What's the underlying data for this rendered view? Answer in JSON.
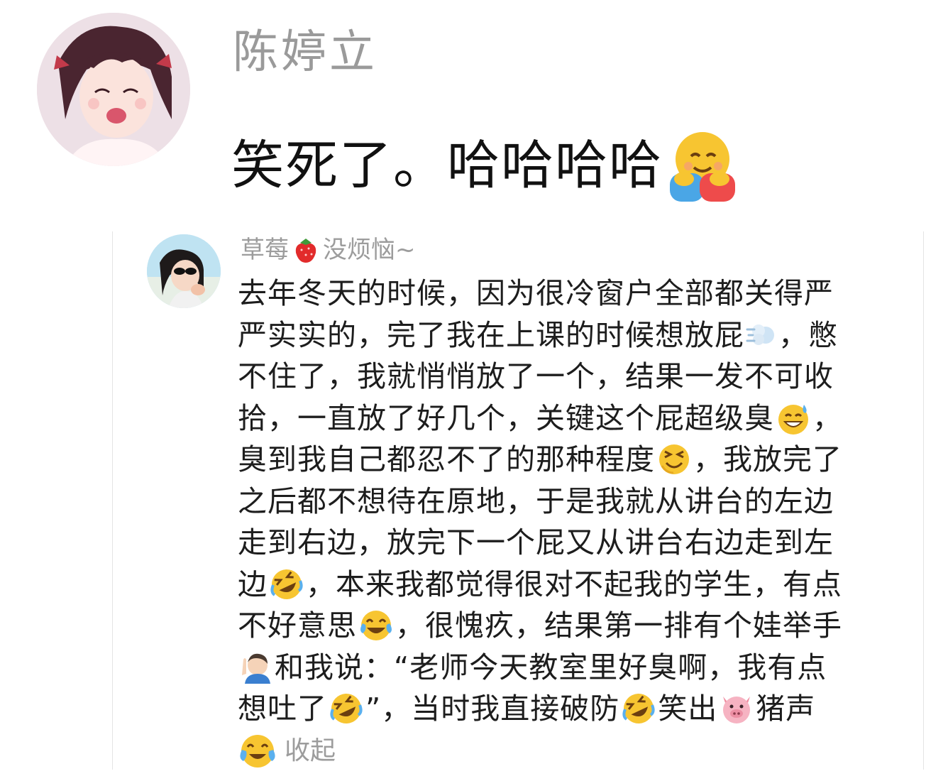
{
  "top_comment": {
    "username": "陈婷立",
    "text": "笑死了。哈哈哈哈",
    "trailing_emoji": "hugging-face-icon"
  },
  "quoted_comment": {
    "username_part1": "草莓",
    "name_emoji": "strawberry-icon",
    "username_part2": "没烦恼~",
    "lines": [
      [
        "去年冬天的时候，因为很冷窗户全部都关得严"
      ],
      [
        "严实实的，完了我在上课的时候想放屁",
        "[dash-emoji]",
        "，憋"
      ],
      [
        "不住了，我就悄悄放了一个，结果一发不可收"
      ],
      [
        "拾，一直放了好几个，关键这个屁超级臭",
        "[sweat-smile-emoji]",
        "，"
      ],
      [
        "臭到我自己都忍不了的那种程度",
        "[squint-emoji]",
        "，我放完了"
      ],
      [
        "之后都不想待在原地，于是我就从讲台的左边"
      ],
      [
        "走到右边，放完下一个屁又从讲台右边走到左"
      ],
      [
        "边",
        "[rofl-emoji]",
        "，本来我都觉得很对不起我的学生，有点"
      ],
      [
        "不好意思",
        "[joy-emoji]",
        "，很愧疚，结果第一排有个娃举手"
      ],
      [
        "[raising-hand-emoji]",
        "和我说：“老师今天教室里好臭啊，我有点"
      ],
      [
        "想吐了",
        "[rofl-emoji]",
        "”，当时我直接破防",
        "[rofl-emoji]",
        "笑出",
        "[pig-emoji]",
        "猪声"
      ]
    ],
    "collapse_label": "收起",
    "collapse_emoji": "tearful-joy-icon"
  },
  "colors": {
    "username_gray": "#9a9a9a",
    "text_dark": "#1d1d1d",
    "emoji_yellow": "#f7c531"
  }
}
